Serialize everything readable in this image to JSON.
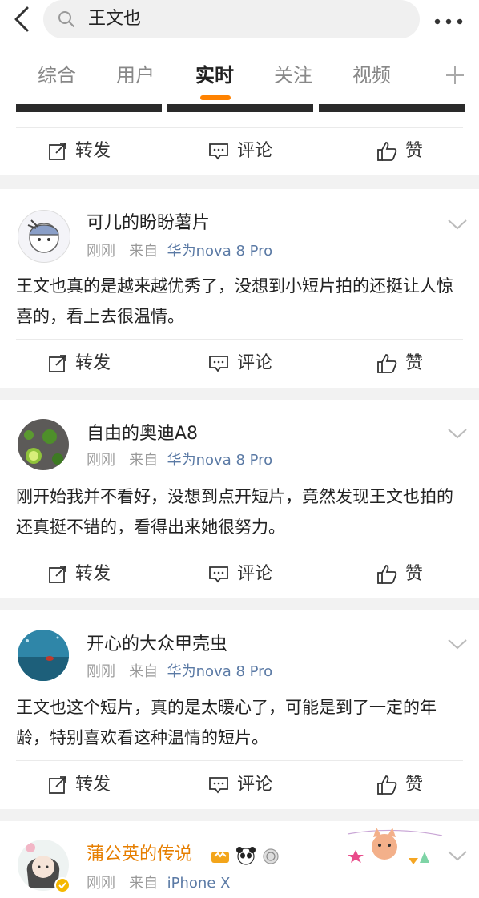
{
  "search": {
    "query": "王文也"
  },
  "tabs": [
    "综合",
    "用户",
    "实时",
    "关注",
    "视频"
  ],
  "actions": {
    "repost": "转发",
    "comment": "评论",
    "like": "赞"
  },
  "posts": [
    {
      "username": "可儿的盼盼薯片",
      "time": "刚刚",
      "from": "来自",
      "device": "华为nova 8 Pro",
      "text": "王文也真的是越来越优秀了，没想到小短片拍的还挺让人惊喜的，看上去很温情。"
    },
    {
      "username": "自由的奥迪A8",
      "time": "刚刚",
      "from": "来自",
      "device": "华为nova 8 Pro",
      "text": "刚开始我并不看好，没想到点开短片，竟然发现王文也拍的还真挺不错的，看得出来她很努力。"
    },
    {
      "username": "开心的大众甲壳虫",
      "time": "刚刚",
      "from": "来自",
      "device": "华为nova 8 Pro",
      "text": "王文也这个短片，真的是太暖心了，可能是到了一定的年龄，特别喜欢看这种温情的短片。"
    },
    {
      "username": "蒲公英的传说",
      "time": "刚刚",
      "from": "来自",
      "device": "iPhone X"
    }
  ],
  "colors": {
    "accent": "#ff8200",
    "source_link": "#5b7aa5",
    "vip_name": "#e67e00"
  }
}
